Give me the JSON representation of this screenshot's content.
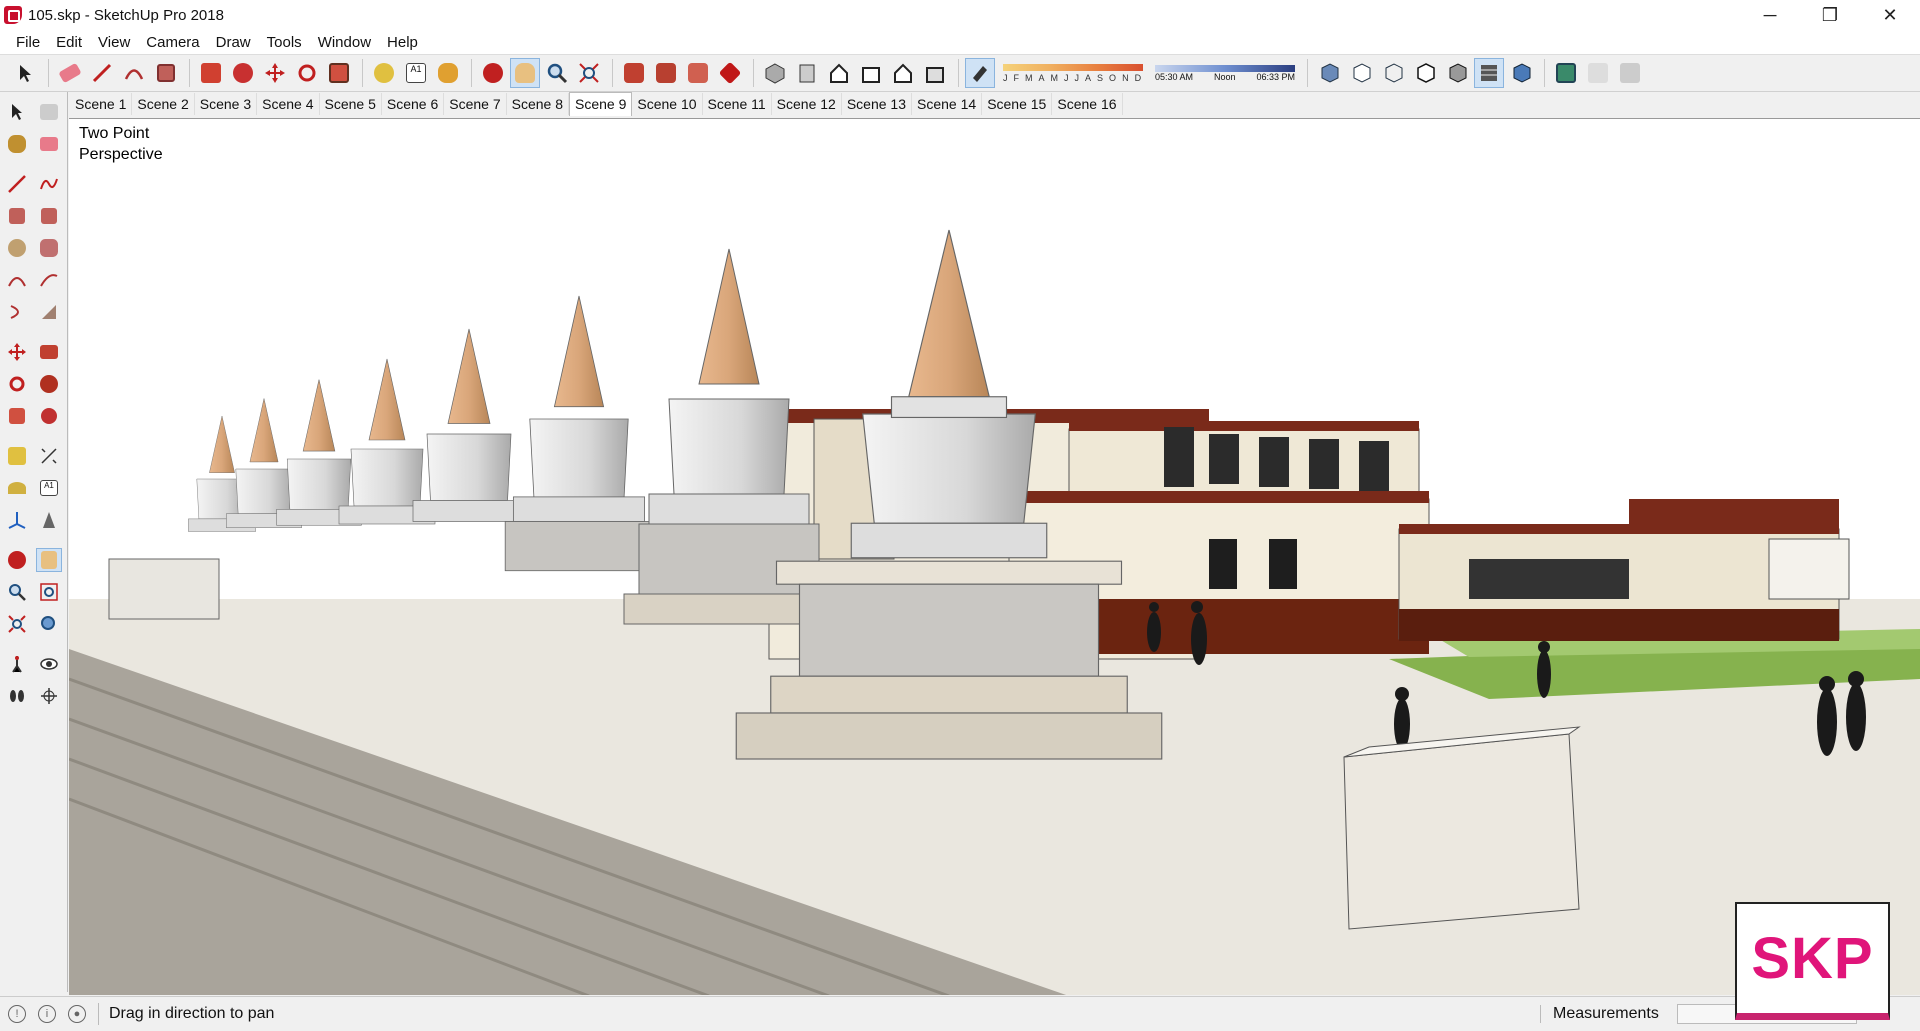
{
  "window": {
    "title": "105.skp - SketchUp Pro 2018",
    "minimize": "─",
    "restore": "❐",
    "close": "✕"
  },
  "menu": [
    "File",
    "Edit",
    "View",
    "Camera",
    "Draw",
    "Tools",
    "Window",
    "Help"
  ],
  "shadow": {
    "months": [
      "J",
      "F",
      "M",
      "A",
      "M",
      "J",
      "J",
      "A",
      "S",
      "O",
      "N",
      "D"
    ],
    "time_start": "05:30 AM",
    "time_mid": "Noon",
    "time_end": "06:33 PM"
  },
  "scenes": [
    "Scene 1",
    "Scene 2",
    "Scene 3",
    "Scene 4",
    "Scene 5",
    "Scene 6",
    "Scene 7",
    "Scene 8",
    "Scene 9",
    "Scene 10",
    "Scene 11",
    "Scene 12",
    "Scene 13",
    "Scene 14",
    "Scene 15",
    "Scene 16"
  ],
  "active_scene": "Scene 9",
  "viewport": {
    "label_line1": "Two Point",
    "label_line2": "Perspective"
  },
  "status": {
    "hint": "Drag in direction to pan",
    "measurements_label": "Measurements",
    "measurements_value": ""
  },
  "logo": {
    "text": "SKP"
  },
  "colors": {
    "accent": "#c8246e",
    "active_tool": "#cfe2f5",
    "stupa_cone": "#d8a57a",
    "building_trim": "#7a2a1a"
  }
}
